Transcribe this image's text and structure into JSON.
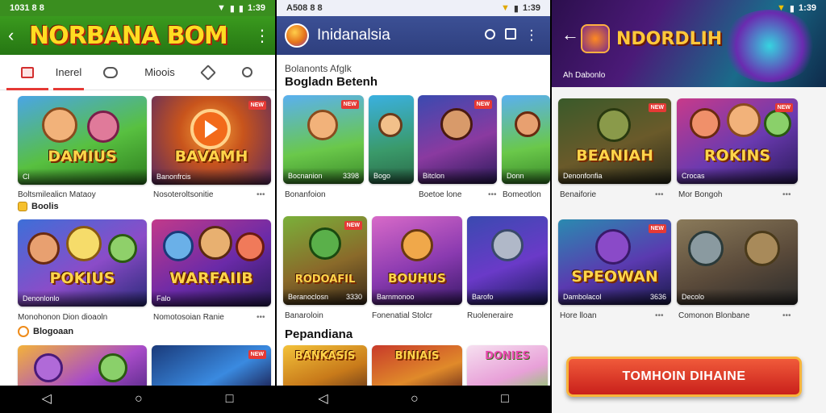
{
  "panel1": {
    "status": {
      "left": "1031 8 8",
      "right": "1:39"
    },
    "appbar": {
      "title": "NORBANA BOM"
    },
    "tabs": [
      {
        "label": "Inerel",
        "icon": "store-icon",
        "active": true
      },
      {
        "label": "",
        "icon": "gamepad-icon"
      },
      {
        "label": "Mioois",
        "icon": ""
      },
      {
        "label": "",
        "icon": "tag-icon"
      },
      {
        "label": "",
        "icon": "search-icon"
      }
    ],
    "cards": [
      {
        "banner": "DAMIUS",
        "cap_left": "Cl",
        "cap_right": "",
        "badge": ""
      },
      {
        "banner": "BAVAMH",
        "cap_left": "Banonfrcis",
        "cap_right": "",
        "badge": "NEW"
      },
      {
        "banner": "POKIUS",
        "cap_left": "Denonlonlo",
        "cap_right": "",
        "badge": ""
      },
      {
        "banner": "WARFAIIB",
        "cap_left": "Falo",
        "cap_right": "",
        "badge": ""
      },
      {
        "banner": "",
        "cap_left": "",
        "cap_right": "",
        "badge": ""
      },
      {
        "banner": "",
        "cap_left": "",
        "cap_right": "",
        "badge": "NEW"
      }
    ],
    "labels": {
      "row1_left": "Boltsmilealicn Mataoy",
      "row1_sub": "Boolis",
      "row1_right": "Nosoteroltsonitie",
      "row2_left": "Monohonon Dion dioaoln",
      "row2_sub": "Blogoaan",
      "row2_right": "Nomotosoian Ranie"
    }
  },
  "panel2": {
    "status": {
      "left": "A508 8 8",
      "right": "1:39"
    },
    "appbar": {
      "title": "Inidanalsia"
    },
    "section1": {
      "caption": "Bolanonts Afglk",
      "title": "Bogladn Betenh"
    },
    "row1": [
      {
        "cap_left": "Bocnanion",
        "cap_right": "3398",
        "badge": "NEW"
      },
      {
        "cap_left": "Bogo",
        "cap_right": "",
        "badge": ""
      },
      {
        "cap_left": "Bitclon",
        "cap_right": "",
        "badge": "NEW"
      },
      {
        "cap_left": "Donn",
        "cap_right": "",
        "badge": ""
      }
    ],
    "row1_labels": {
      "left": "Bonanfoion",
      "mid": "Boetoe lone",
      "right": "Bomeotlon"
    },
    "row2": [
      {
        "banner": "RODOAFIL",
        "cap_left": "Beranoclosn",
        "cap_right": "3330",
        "badge": "NEW"
      },
      {
        "banner": "BOUHUS",
        "cap_left": "Barnmonoo",
        "cap_right": "",
        "badge": ""
      },
      {
        "banner": "",
        "cap_left": "Barofo",
        "cap_right": "",
        "badge": ""
      }
    ],
    "row2_labels": {
      "left": "Banaroloin",
      "mid": "Fonenatial Stolcr",
      "right": "Ruoleneraire"
    },
    "section2": {
      "title": "Pepandiana"
    },
    "row3": [
      {
        "banner": "BANKASIS"
      },
      {
        "banner": "BINIAIS"
      },
      {
        "banner": "DONIES"
      }
    ]
  },
  "panel3": {
    "status": {
      "left": "",
      "right": "1:39"
    },
    "hero": {
      "title": "NDORDLIH",
      "subtitle": "Ah Dabonlo"
    },
    "cards": [
      {
        "banner": "BEANIAH",
        "cap_left": "Denonfonfia",
        "cap_right": "",
        "badge": "NEW"
      },
      {
        "banner": "ROKINS",
        "cap_left": "Crocas",
        "cap_right": "",
        "badge": "NEW"
      },
      {
        "banner": "SPEOWAN",
        "cap_left": "Dambolacol",
        "cap_right": "3636",
        "badge": "NEW"
      },
      {
        "banner": "",
        "cap_left": "Decolo",
        "cap_right": "",
        "badge": ""
      }
    ],
    "labels": {
      "row1_left": "Benaiforie",
      "row1_right": "Mor Bongoh",
      "row2_left": "Hore lloan",
      "row2_right": "Comonon Blonbane"
    },
    "install_label": "TOMHOIN DIHAINE"
  }
}
